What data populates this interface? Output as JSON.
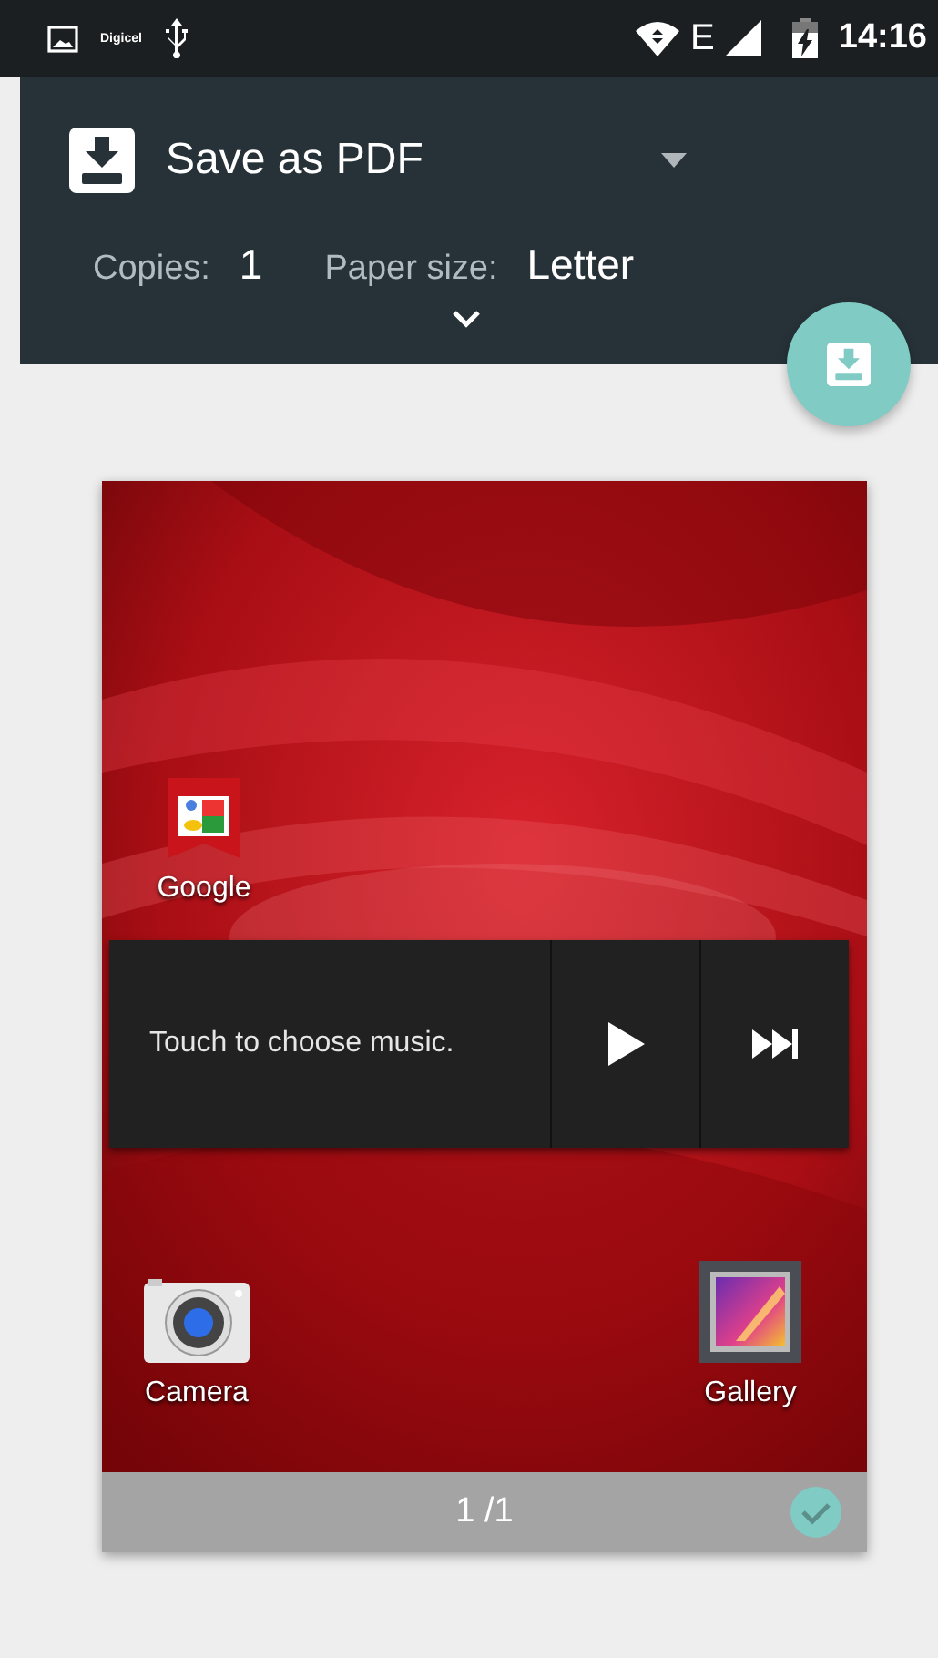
{
  "status_bar": {
    "carrier": "Digicel",
    "network": "E",
    "time": "14:16"
  },
  "printer": {
    "name": "Save as PDF"
  },
  "options": [
    {
      "label": "Copies:",
      "value": "1"
    },
    {
      "label": "Paper size:",
      "value": "Letter"
    }
  ],
  "preview": {
    "selected": true,
    "page_number": "1 /1",
    "home_screen": {
      "apps": [
        {
          "kind": "bookmark",
          "label": "Google"
        },
        {
          "kind": "camera",
          "label": "Camera"
        },
        {
          "kind": "gallery",
          "label": "Gallery"
        }
      ],
      "music_widget": {
        "text": "Touch to choose music."
      }
    }
  }
}
